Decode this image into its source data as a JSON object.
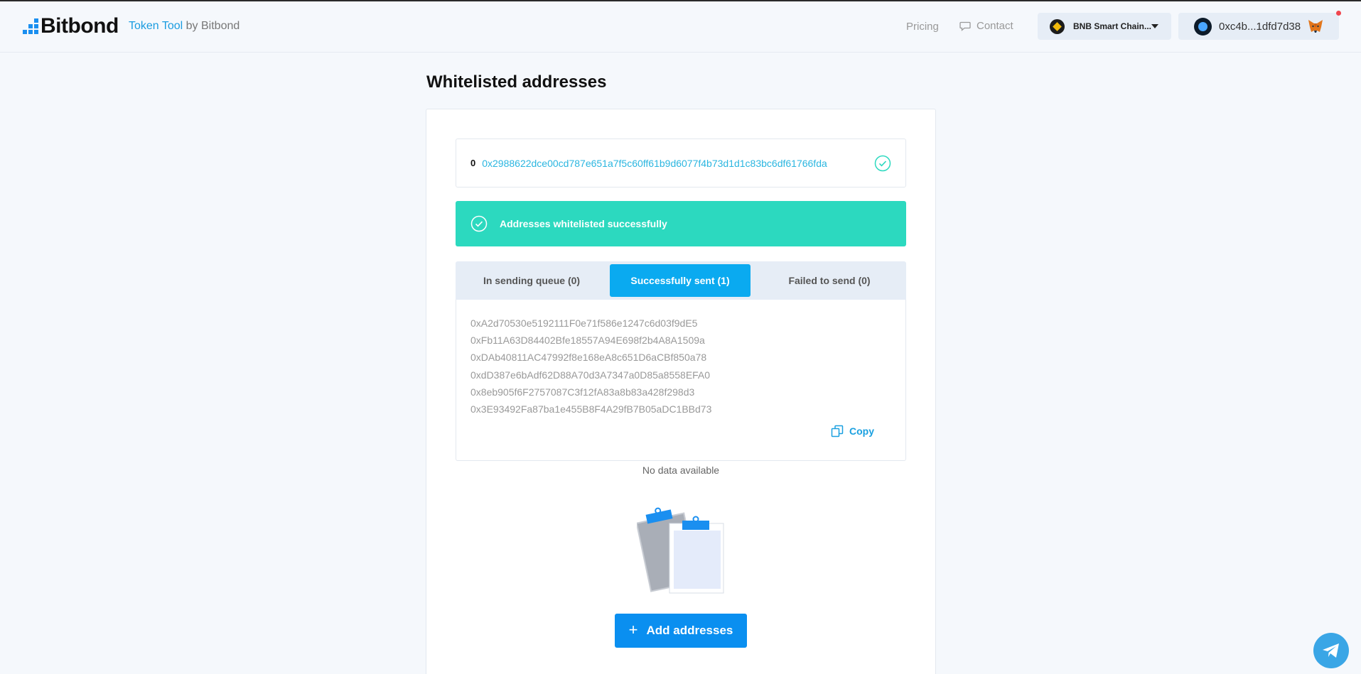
{
  "header": {
    "logo_text": "Bitbond",
    "subtitle_tool": "Token Tool",
    "subtitle_by": "by Bitbond",
    "nav": {
      "pricing": "Pricing",
      "contact": "Contact"
    },
    "chain": {
      "label": "BNB Smart Chain...",
      "icon": "bnb-icon"
    },
    "wallet": {
      "address": "0xc4b...1dfd7d38",
      "icon": "metamask-fox-icon"
    },
    "colors": {
      "brand": "#1a8ff0",
      "accent": "#2bb6e0"
    }
  },
  "page": {
    "title": "Whitelisted addresses"
  },
  "transaction": {
    "index": "0",
    "hash": "0x2988622dce00cd787e651a7f5c60ff61b9d6077f4b73d1d1c83bc6df61766fda",
    "status_icon": "check-circle-icon"
  },
  "banner": {
    "text": "Addresses whitelisted successfully",
    "color": "#2cd9bf"
  },
  "tabs": [
    {
      "label": "In sending queue (0)",
      "active": false
    },
    {
      "label": "Successfully sent (1)",
      "active": true
    },
    {
      "label": "Failed to send (0)",
      "active": false
    }
  ],
  "addresses": [
    "0xA2d70530e5192111F0e71f586e1247c6d03f9dE5",
    "0xFb11A63D84402Bfe18557A94E698f2b4A8A1509a",
    "0xDAb40811AC47992f8e168eA8c651D6aCBf850a78",
    "0xdD387e6bAdf62D88A70d3A7347a0D85a8558EFA0",
    "0x8eb905f6F2757087C3f12fA83a8b83a428f298d3",
    "0x3E93492Fa87ba1e455B8F4A29fB7B05aDC1BBd73"
  ],
  "copy_label": "Copy",
  "empty_state": {
    "text": "No data available",
    "icon": "empty-clipboard-illustration"
  },
  "add_button": {
    "label": "Add addresses",
    "icon": "plus-icon"
  },
  "telegram": {
    "icon": "telegram-icon"
  }
}
